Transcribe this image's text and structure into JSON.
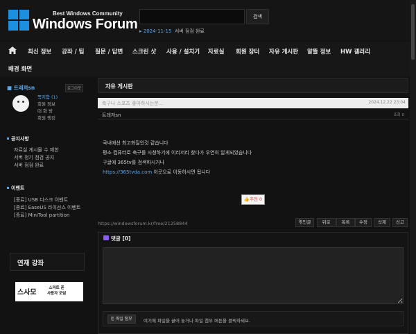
{
  "header": {
    "logo_sub": "Best Windows Community",
    "logo_main": "Windows Forum",
    "search_value": "",
    "search_button": "검색",
    "notice_date": "2024-11-15",
    "notice_text": "서버 점검 완료"
  },
  "nav": {
    "items": [
      "최신 정보",
      "강좌 / 팁",
      "질문 / 답변",
      "스크린 샷",
      "사용 / 설치기",
      "자료실",
      "회원 장터",
      "자유 게시판",
      "알뜰 정보",
      "HW 갤러리",
      "배경 화면"
    ]
  },
  "profile": {
    "name": "트레져sn",
    "logout": "로그아웃",
    "links": [
      "쪽지함 (1)",
      "회원 정보",
      "대 화 방",
      "회원 랭킹"
    ]
  },
  "notice_section": {
    "title": "공지사항",
    "items": [
      "자료실 게시물 수 제한",
      "서버 정기 점검 공지",
      "서버 점검 완료"
    ]
  },
  "event_section": {
    "title": "이벤트",
    "items": [
      "[종료] USB 디스크 이벤트",
      "[종료] EaseUS 라이선스 이벤트",
      "[종료] MiniTool partition"
    ]
  },
  "course": {
    "title": "연재 강좌",
    "banner_main": "스사모",
    "banner_sub1": "스마트 폰",
    "banner_sub2": "사용자 모임"
  },
  "board": {
    "title": "자유 게시판",
    "post_title": "축구나 스포츠 좋아하시는분...",
    "post_date": "2024.12.22 23:04",
    "author": "트레져sn",
    "views": "조회 0",
    "content_lines": [
      "국내에선 최고화질인것 같습니다",
      "평소 컴퓨터로 축구를 시청하기에 이리저리 찾다가 우연히 알게되었습니다",
      "구글에 365tv를 검색하시거나"
    ],
    "link_text": "https://365tvda.com",
    "link_suffix": " 이곳으로 이동하시면 됩니다",
    "recommend": "추천 0",
    "url": "https://windowsforum.kr/free/21258844",
    "actions": [
      "엮인글",
      "위로",
      "목록",
      "수정",
      "삭제",
      "신고"
    ]
  },
  "comment": {
    "title": "댓글 [0]",
    "attach_button": "파일 첨부",
    "attach_hint": "여기에 파일을 끌어 놓거나 파일 첨부 버튼을 클릭하세요."
  }
}
